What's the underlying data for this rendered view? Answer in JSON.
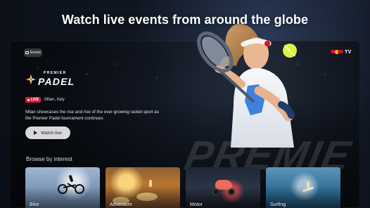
{
  "headline": "Watch live events from around the globe",
  "hero": {
    "events_chip_label": "Events",
    "brand_text": "TV",
    "logo_top": "PREMIER",
    "logo_main": "PADEL",
    "live_label": "LIVE",
    "location": "Milan, Italy",
    "description": "Milan showcases the rise and rise of the ever-growing racket sport as the Premier Padel tournament continues",
    "watch_button_label": "Watch live",
    "background_text": "PREMIE"
  },
  "browse": {
    "title": "Browse by interest",
    "items": [
      {
        "label": "Bike"
      },
      {
        "label": "Adventure"
      },
      {
        "label": "Motor"
      },
      {
        "label": "Surfing"
      }
    ]
  },
  "colors": {
    "live_red": "#d41f3a",
    "button_bg": "#d8d8db",
    "background": "#0b1017",
    "brand_red": "#d90f2d",
    "brand_yellow": "#ffcc00",
    "ball": "#d9f046"
  },
  "icons": {
    "events_chip": "calendar-icon",
    "brand": "redbull-tv-logo",
    "logo_star": "padel-star-logo",
    "watch_button": "play-icon"
  }
}
